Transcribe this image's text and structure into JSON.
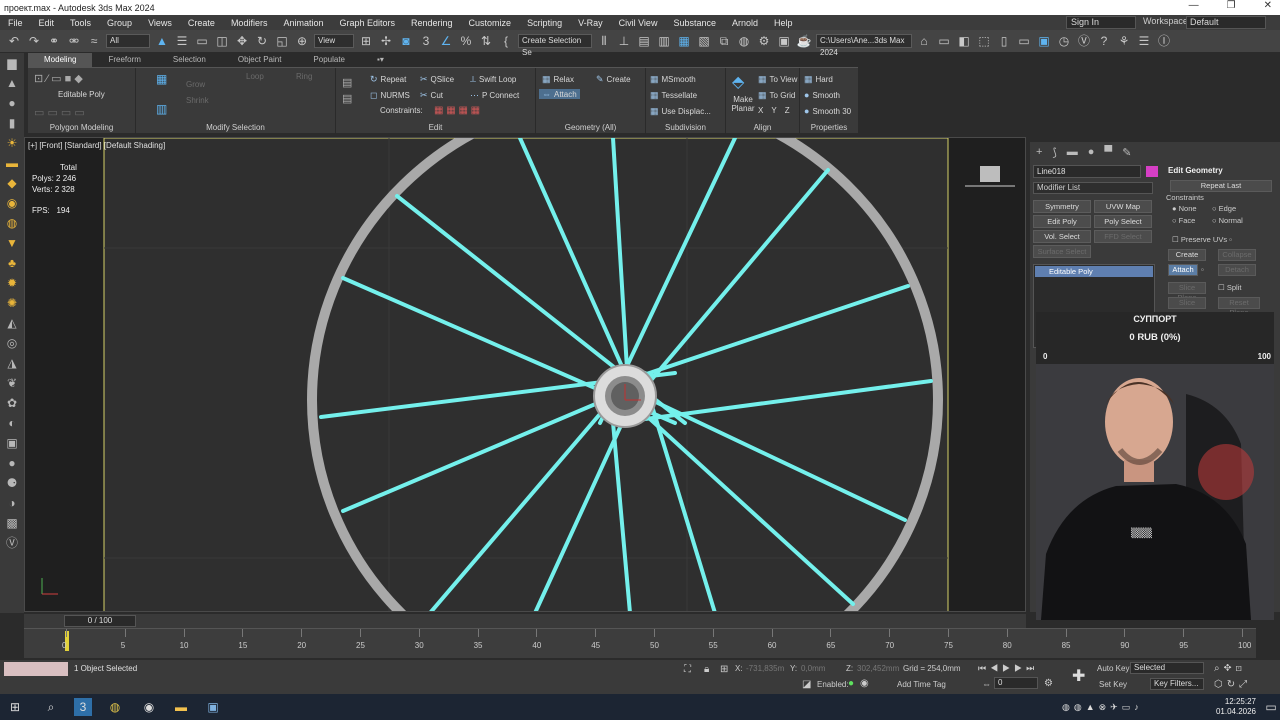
{
  "window": {
    "title": "проект.max - Autodesk 3ds Max 2024",
    "controls": [
      "—",
      "❐",
      "✕"
    ]
  },
  "menu": {
    "items": [
      "File",
      "Edit",
      "Tools",
      "Group",
      "Views",
      "Create",
      "Modifiers",
      "Animation",
      "Graph Editors",
      "Rendering",
      "Customize",
      "Scripting",
      "V-Ray",
      "Civil View",
      "Substance",
      "Arnold",
      "Help"
    ],
    "sign_in": "Sign In",
    "workspaces_label": "Workspaces:",
    "workspaces_value": "Default"
  },
  "main_toolbar": {
    "filter": "All",
    "ref_coord": "View",
    "selection_set": "Create Selection Se",
    "project_path": "C:\\Users\\Ane...3ds Max 2024"
  },
  "ribbon": {
    "tabs": [
      "Modeling",
      "Freeform",
      "Selection",
      "Object Paint",
      "Populate"
    ],
    "active_tab": "Modeling",
    "editable_poly_label": "Editable Poly",
    "groups": {
      "polygon_modeling": "Polygon Modeling",
      "modify_selection": "Modify Selection",
      "edit": "Edit",
      "geometry": "Geometry (All)",
      "subdivision": "Subdivision",
      "align": "Align",
      "properties": "Properties"
    },
    "modsel": {
      "grow": "Grow",
      "shrink": "Shrink",
      "loop": "Loop",
      "ring": "Ring"
    },
    "edit": {
      "repeat": "Repeat",
      "qslice": "QSlice",
      "swift_loop": "Swift Loop",
      "nurms": "NURMS",
      "cut": "Cut",
      "p_connect": "P Connect",
      "constraints": "Constraints:"
    },
    "geometry": {
      "relax": "Relax",
      "create": "Create",
      "attach": "Attach"
    },
    "subdivision": {
      "msmooth": "MSmooth",
      "tessellate": "Tessellate",
      "use_displac": "Use Displac..."
    },
    "align": {
      "make_planar": "Make Planar",
      "to_view": "To View",
      "to_grid": "To Grid",
      "x": "X",
      "y": "Y",
      "z": "Z"
    },
    "properties": {
      "hard": "Hard",
      "smooth": "Smooth",
      "smooth30": "Smooth 30"
    }
  },
  "viewport": {
    "label": "[+] [Front] [Standard] [Default Shading]",
    "stats": {
      "total": "Total",
      "polys_label": "Polys:",
      "polys": "2 246",
      "verts_label": "Verts:",
      "verts": "2 328",
      "fps_label": "FPS:",
      "fps": "194"
    }
  },
  "command_panel": {
    "tab_icons": [
      "+",
      "⟆",
      "▬",
      "●",
      "▀",
      "✎"
    ],
    "object_name": "Line018",
    "object_color": "#d63fc5",
    "modifier_list": "Modifier List",
    "buttons": [
      "Symmetry",
      "UVW Map",
      "Edit Poly",
      "Poly Select",
      "Vol. Select",
      "FFD Select",
      "Surface Select"
    ],
    "stack_item": "Editable Poly",
    "edit_geometry": {
      "title": "Edit Geometry",
      "repeat_last": "Repeat Last",
      "constraints": "Constraints",
      "none": "None",
      "edge": "Edge",
      "face": "Face",
      "normal": "Normal",
      "preserve_uvs": "Preserve UVs",
      "create": "Create",
      "collapse": "Collapse",
      "attach": "Attach",
      "detach": "Detach",
      "slice_plane": "Slice Plane",
      "split": "Split",
      "slice": "Slice",
      "reset_plane": "Reset Plane"
    }
  },
  "support_widget": {
    "title": "СУППОРТ",
    "amount": "0 RUB (0%)",
    "min": "0",
    "max": "100"
  },
  "timeline": {
    "frame": "0 / 100",
    "ticks": [
      "0",
      "5",
      "10",
      "15",
      "20",
      "25",
      "30",
      "35",
      "40",
      "45",
      "50",
      "55",
      "60",
      "65",
      "70",
      "75",
      "80",
      "85",
      "90",
      "95",
      "100"
    ]
  },
  "status": {
    "selection": "1 Object Selected",
    "x_label": "X:",
    "x_value": "-731,835m",
    "y_label": "Y:",
    "y_value": "0,0mm",
    "z_label": "Z:",
    "z_value": "302,452mm",
    "grid": "Grid = 254,0mm",
    "enabled": "Enabled:",
    "add_time_tag": "Add Time Tag",
    "auto_key": "Auto Key",
    "set_key": "Set Key",
    "selected": "Selected",
    "key_filters": "Key Filters...",
    "frame_field": "0"
  },
  "taskbar": {
    "time": "12:25:27",
    "date": "01.04.2026"
  }
}
